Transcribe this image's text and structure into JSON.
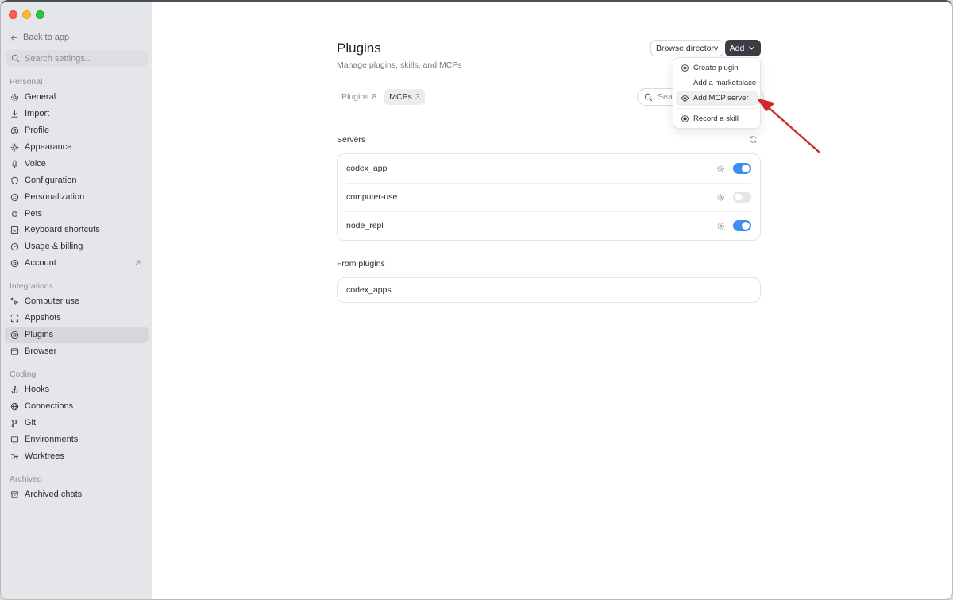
{
  "sidebar": {
    "back_label": "Back to app",
    "search_placeholder": "Search settings...",
    "sections": [
      {
        "label": "Personal"
      },
      {
        "label": "Integrations"
      },
      {
        "label": "Coding"
      },
      {
        "label": "Archived"
      }
    ],
    "items": [
      {
        "label": "General",
        "icon": "gear-icon"
      },
      {
        "label": "Import",
        "icon": "download-icon"
      },
      {
        "label": "Profile",
        "icon": "person-icon"
      },
      {
        "label": "Appearance",
        "icon": "sun-icon"
      },
      {
        "label": "Voice",
        "icon": "microphone-icon"
      },
      {
        "label": "Configuration",
        "icon": "shield-icon"
      },
      {
        "label": "Personalization",
        "icon": "smile-icon"
      },
      {
        "label": "Pets",
        "icon": "pet-icon"
      },
      {
        "label": "Keyboard shortcuts",
        "icon": "keyboard-icon"
      },
      {
        "label": "Usage & billing",
        "icon": "gauge-icon"
      },
      {
        "label": "Account",
        "icon": "account-icon"
      },
      {
        "label": "Computer use",
        "icon": "cursor-icon"
      },
      {
        "label": "Appshots",
        "icon": "screenshot-icon"
      },
      {
        "label": "Plugins",
        "icon": "plugin-icon"
      },
      {
        "label": "Browser",
        "icon": "browser-icon"
      },
      {
        "label": "Hooks",
        "icon": "anchor-icon"
      },
      {
        "label": "Connections",
        "icon": "globe-icon"
      },
      {
        "label": "Git",
        "icon": "git-branch-icon"
      },
      {
        "label": "Environments",
        "icon": "monitor-icon"
      },
      {
        "label": "Worktrees",
        "icon": "worktree-icon"
      },
      {
        "label": "Archived chats",
        "icon": "archive-icon"
      }
    ],
    "active_item": "Plugins"
  },
  "header": {
    "title": "Plugins",
    "subtitle": "Manage plugins, skills, and MCPs",
    "browse_label": "Browse directory",
    "add_label": "Add"
  },
  "tabs": [
    {
      "label": "Plugins",
      "count": "8",
      "active": false
    },
    {
      "label": "MCPs",
      "count": "3",
      "active": true
    }
  ],
  "search": {
    "placeholder": "Search"
  },
  "servers": {
    "title": "Servers",
    "items": [
      {
        "name": "codex_app",
        "enabled": true
      },
      {
        "name": "computer-use",
        "enabled": false
      },
      {
        "name": "node_repl",
        "enabled": true
      }
    ]
  },
  "from_plugins": {
    "title": "From plugins",
    "items": [
      {
        "name": "codex_apps"
      }
    ]
  },
  "add_menu": {
    "items": [
      {
        "label": "Create plugin",
        "icon": "plugin-icon"
      },
      {
        "label": "Add a marketplace",
        "icon": "plus-icon"
      },
      {
        "label": "Add MCP server",
        "icon": "mcp-icon",
        "highlighted": true
      },
      {
        "label": "Record a skill",
        "icon": "record-icon"
      }
    ]
  },
  "colors": {
    "accent": "#3b8fef",
    "annotation_arrow": "#d0262d"
  }
}
